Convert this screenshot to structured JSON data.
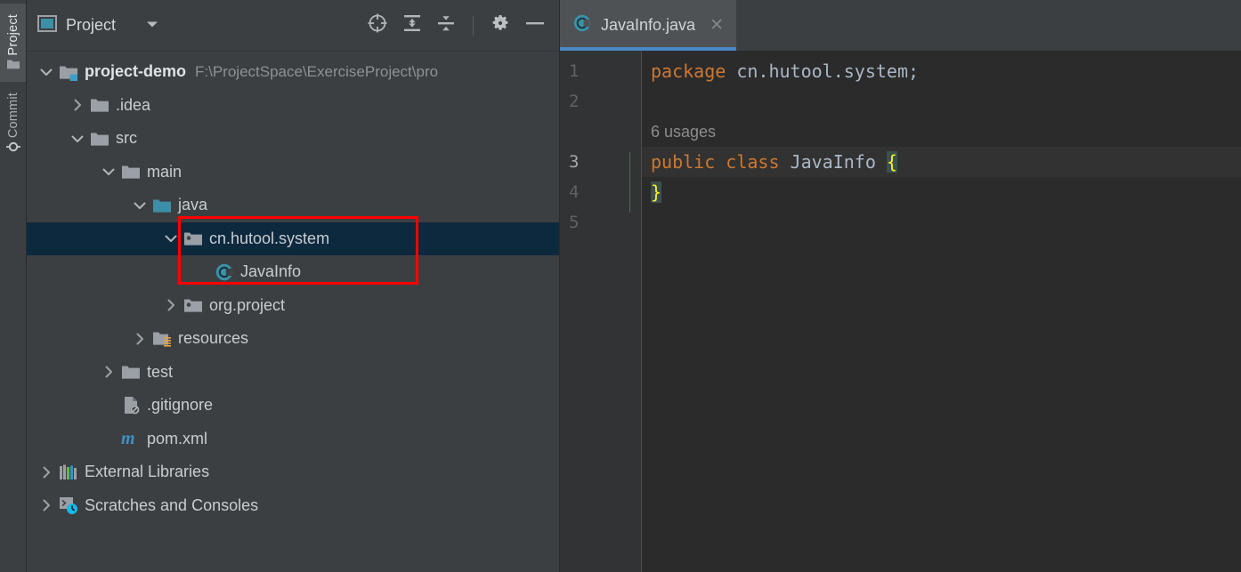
{
  "stripe": {
    "buttons": [
      {
        "label": "Project",
        "icon": "project-folder-icon",
        "active": true
      },
      {
        "label": "Commit",
        "icon": "commit-node-icon",
        "active": false
      }
    ]
  },
  "project_panel": {
    "title": "Project",
    "title_icon": "project-window-icon",
    "dropdown_icon": "chevron-down-icon",
    "toolbar": [
      {
        "name": "locate-file-button",
        "icon": "crosshair-target-icon",
        "tooltip": "Select Opened File"
      },
      {
        "name": "expand-all-button",
        "icon": "expand-all-icon",
        "tooltip": "Expand All"
      },
      {
        "name": "collapse-all-button",
        "icon": "collapse-all-icon",
        "tooltip": "Collapse All"
      },
      {
        "name": "settings-button",
        "icon": "gear-icon",
        "tooltip": "Options"
      },
      {
        "name": "hide-button",
        "icon": "minimize-dash-icon",
        "tooltip": "Hide"
      }
    ],
    "tree": [
      {
        "label": "project-demo",
        "path": "F:\\ProjectSpace\\ExerciseProject\\pro",
        "icon": "module-icon",
        "arrow": "expanded",
        "depth": 0,
        "bold": true,
        "selected": false
      },
      {
        "label": ".idea",
        "path": "",
        "icon": "folder-icon",
        "arrow": "collapsed",
        "depth": 1,
        "bold": false,
        "selected": false
      },
      {
        "label": "src",
        "path": "",
        "icon": "folder-icon",
        "arrow": "expanded",
        "depth": 1,
        "bold": false,
        "selected": false
      },
      {
        "label": "main",
        "path": "",
        "icon": "folder-icon",
        "arrow": "expanded",
        "depth": 2,
        "bold": false,
        "selected": false
      },
      {
        "label": "java",
        "path": "",
        "icon": "source-root-folder-icon",
        "arrow": "expanded",
        "depth": 3,
        "bold": false,
        "selected": false
      },
      {
        "label": "cn.hutool.system",
        "path": "",
        "icon": "package-icon",
        "arrow": "expanded",
        "depth": 4,
        "bold": false,
        "selected": true
      },
      {
        "label": "JavaInfo",
        "path": "",
        "icon": "java-class-icon",
        "arrow": "none",
        "depth": 5,
        "bold": false,
        "selected": false
      },
      {
        "label": "org.project",
        "path": "",
        "icon": "package-icon",
        "arrow": "collapsed",
        "depth": 4,
        "bold": false,
        "selected": false
      },
      {
        "label": "resources",
        "path": "",
        "icon": "resources-folder-icon",
        "arrow": "collapsed",
        "depth": 3,
        "bold": false,
        "selected": false
      },
      {
        "label": "test",
        "path": "",
        "icon": "folder-icon",
        "arrow": "collapsed",
        "depth": 2,
        "bold": false,
        "selected": false
      },
      {
        "label": ".gitignore",
        "path": "",
        "icon": "gitignore-file-icon",
        "arrow": "none",
        "depth": 2,
        "bold": false,
        "selected": false
      },
      {
        "label": "pom.xml",
        "path": "",
        "icon": "maven-pom-icon",
        "arrow": "none",
        "depth": 2,
        "bold": false,
        "selected": false
      },
      {
        "label": "External Libraries",
        "path": "",
        "icon": "external-libraries-icon",
        "arrow": "collapsed",
        "depth": 0,
        "bold": false,
        "selected": false
      },
      {
        "label": "Scratches and Consoles",
        "path": "",
        "icon": "scratches-icon",
        "arrow": "collapsed",
        "depth": 0,
        "bold": false,
        "selected": false
      }
    ],
    "annotation": {
      "type": "red-rectangle",
      "color": "#ff0000",
      "surrounds": [
        "cn.hutool.system",
        "JavaInfo"
      ]
    }
  },
  "editor": {
    "tabs": [
      {
        "label": "JavaInfo.java",
        "icon": "java-class-icon",
        "close_icon": "close-x-icon",
        "active": true
      }
    ],
    "gutter_lines": [
      "1",
      "2",
      "3",
      "4",
      "5"
    ],
    "current_line": "3",
    "lines": [
      {
        "number": "1",
        "kind": "code",
        "tokens": [
          {
            "text": "package",
            "style": "kw"
          },
          {
            "text": " cn.hutool.system;",
            "style": "id"
          }
        ]
      },
      {
        "number": "2",
        "kind": "code",
        "tokens": []
      },
      {
        "number": "",
        "kind": "hint",
        "text": "6 usages"
      },
      {
        "number": "3",
        "kind": "code",
        "caret": true,
        "tokens": [
          {
            "text": "public class",
            "style": "kw"
          },
          {
            "text": " JavaInfo ",
            "style": "id"
          },
          {
            "text": "{",
            "style": "brace"
          }
        ]
      },
      {
        "number": "4",
        "kind": "code",
        "tokens": [
          {
            "text": "}",
            "style": "brace"
          }
        ]
      },
      {
        "number": "5",
        "kind": "code",
        "tokens": []
      }
    ]
  },
  "colors": {
    "panel_bg": "#3c3f41",
    "editor_bg": "#2b2b2b",
    "gutter_bg": "#313335",
    "selection_bg": "#0d293e",
    "tab_active_bg": "#4e5254",
    "tab_underline": "#4a88c7",
    "accent_teal": "#3b92a8",
    "keyword_orange": "#cc7832",
    "identifier_blue": "#a9b7c6",
    "brace_yellow": "#ffef28",
    "annotation_red": "#ff0000"
  }
}
